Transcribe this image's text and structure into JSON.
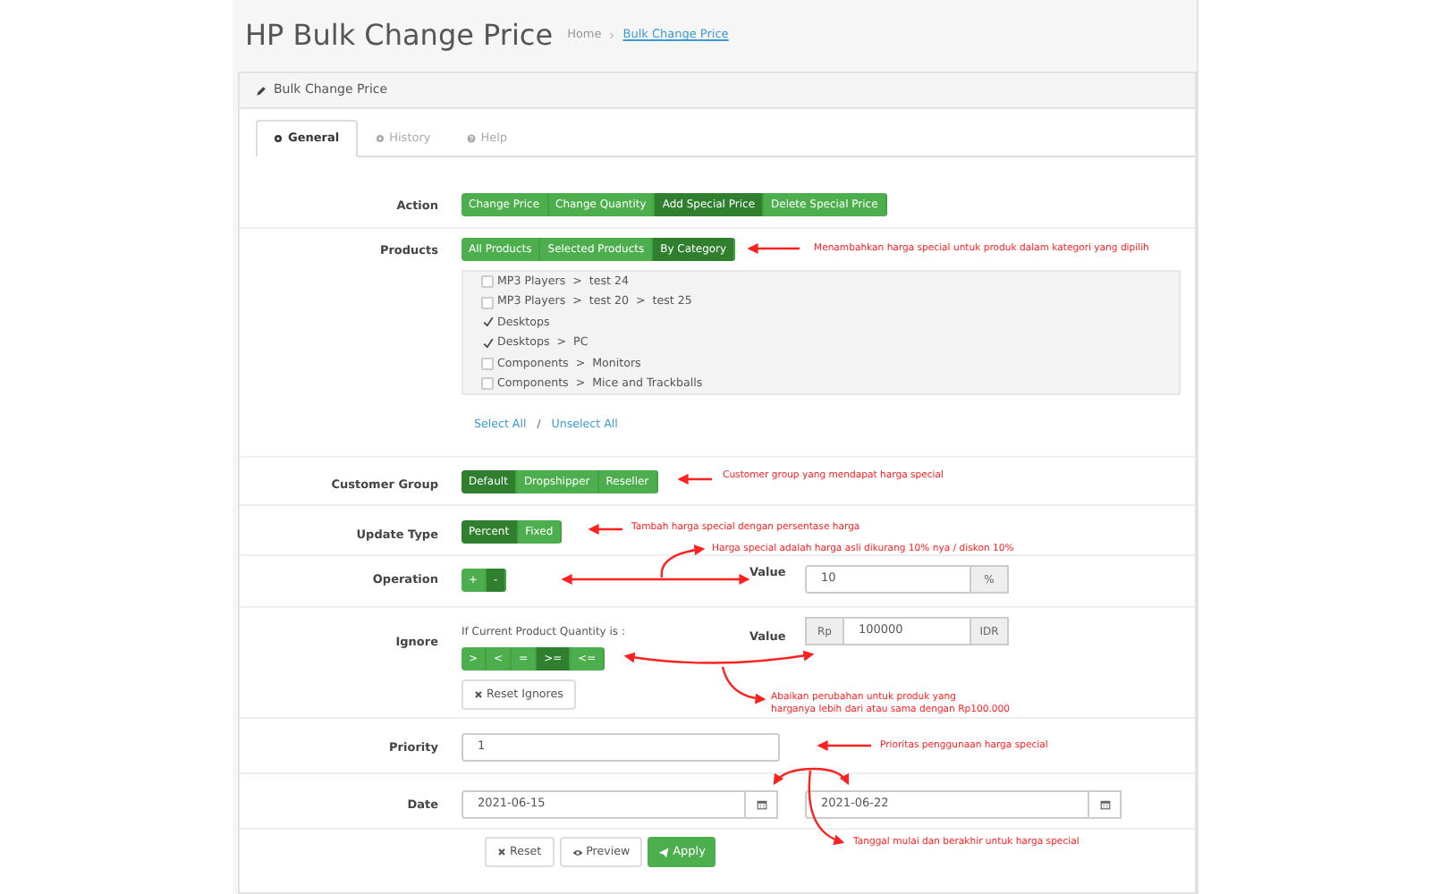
{
  "page_title": "HP Bulk Change Price",
  "breadcrumb": [
    {
      "label": "Home"
    },
    {
      "label": "Bulk Change Price"
    }
  ],
  "panel_title": "Bulk Change Price",
  "tabs": [
    {
      "label": "General",
      "selected": true
    },
    {
      "label": "History",
      "selected": false
    },
    {
      "label": "Help",
      "selected": false
    }
  ],
  "action": {
    "label": "Action",
    "options": [
      {
        "label": "Change Price",
        "selected": false
      },
      {
        "label": "Change Quantity",
        "selected": false
      },
      {
        "label": "Add Special Price",
        "selected": true
      },
      {
        "label": "Delete Special Price",
        "selected": false
      }
    ]
  },
  "products": {
    "label": "Products",
    "options": [
      {
        "label": "All Products",
        "selected": false
      },
      {
        "label": "Selected Products",
        "selected": false
      },
      {
        "label": "By Category",
        "selected": true
      }
    ],
    "categories": [
      {
        "label": "MP3 Players  >  test 24",
        "checked": false
      },
      {
        "label": "MP3 Players  >  test 20  >  test 25",
        "checked": false
      },
      {
        "label": "Desktops",
        "checked": true
      },
      {
        "label": "Desktops  >  PC",
        "checked": true
      },
      {
        "label": "Components  >  Monitors",
        "checked": false
      },
      {
        "label": "Components  >  Mice and Trackballs",
        "checked": false
      }
    ],
    "select_all": "Select All",
    "separator": "/",
    "unselect_all": "Unselect All"
  },
  "customer_group": {
    "label": "Customer Group",
    "options": [
      {
        "label": "Default",
        "selected": true
      },
      {
        "label": "Dropshipper",
        "selected": false
      },
      {
        "label": "Reseller",
        "selected": false
      }
    ]
  },
  "update_type": {
    "label": "Update Type",
    "options": [
      {
        "label": "Percent",
        "selected": true
      },
      {
        "label": "Fixed",
        "selected": false
      }
    ]
  },
  "operation": {
    "label": "Operation",
    "options": [
      {
        "label": "+",
        "selected": false
      },
      {
        "label": "-",
        "selected": true
      }
    ],
    "value_label": "Value",
    "value": "10",
    "suffix": "%"
  },
  "ignore": {
    "label": "Ignore",
    "hint": "If Current Product Quantity is :",
    "options": [
      {
        "label": ">",
        "selected": false
      },
      {
        "label": "<",
        "selected": false
      },
      {
        "label": "=",
        "selected": false
      },
      {
        "label": ">=",
        "selected": true
      },
      {
        "label": "<=",
        "selected": false
      }
    ],
    "reset": "Reset Ignores",
    "value_label": "Value",
    "prefix": "Rp",
    "value": "100000",
    "suffix": "IDR"
  },
  "priority": {
    "label": "Priority",
    "value": "1"
  },
  "date": {
    "label": "Date",
    "start": "2021-06-15",
    "end": "2021-06-22"
  },
  "buttons": [
    {
      "label": "Reset",
      "kind": "reset"
    },
    {
      "label": "Preview",
      "kind": "preview"
    },
    {
      "label": "Apply",
      "kind": "apply"
    }
  ],
  "annotations": [
    {
      "text": "Menambahkan harga special untuk produk dalam kategori yang dipilih"
    },
    {
      "text": "Customer group yang mendapat harga special"
    },
    {
      "text": "Tambah harga special dengan persentase harga"
    },
    {
      "text": "Harga special adalah harga asli dikurang 10% nya / diskon 10%"
    },
    {
      "text": "Abaikan perubahan untuk produk yang\nharganya lebih dari atau sama dengan Rp100.000"
    },
    {
      "text": "Prioritas penggunaan harga special"
    },
    {
      "text": "Tanggal mulai dan berakhir untuk harga special"
    }
  ]
}
